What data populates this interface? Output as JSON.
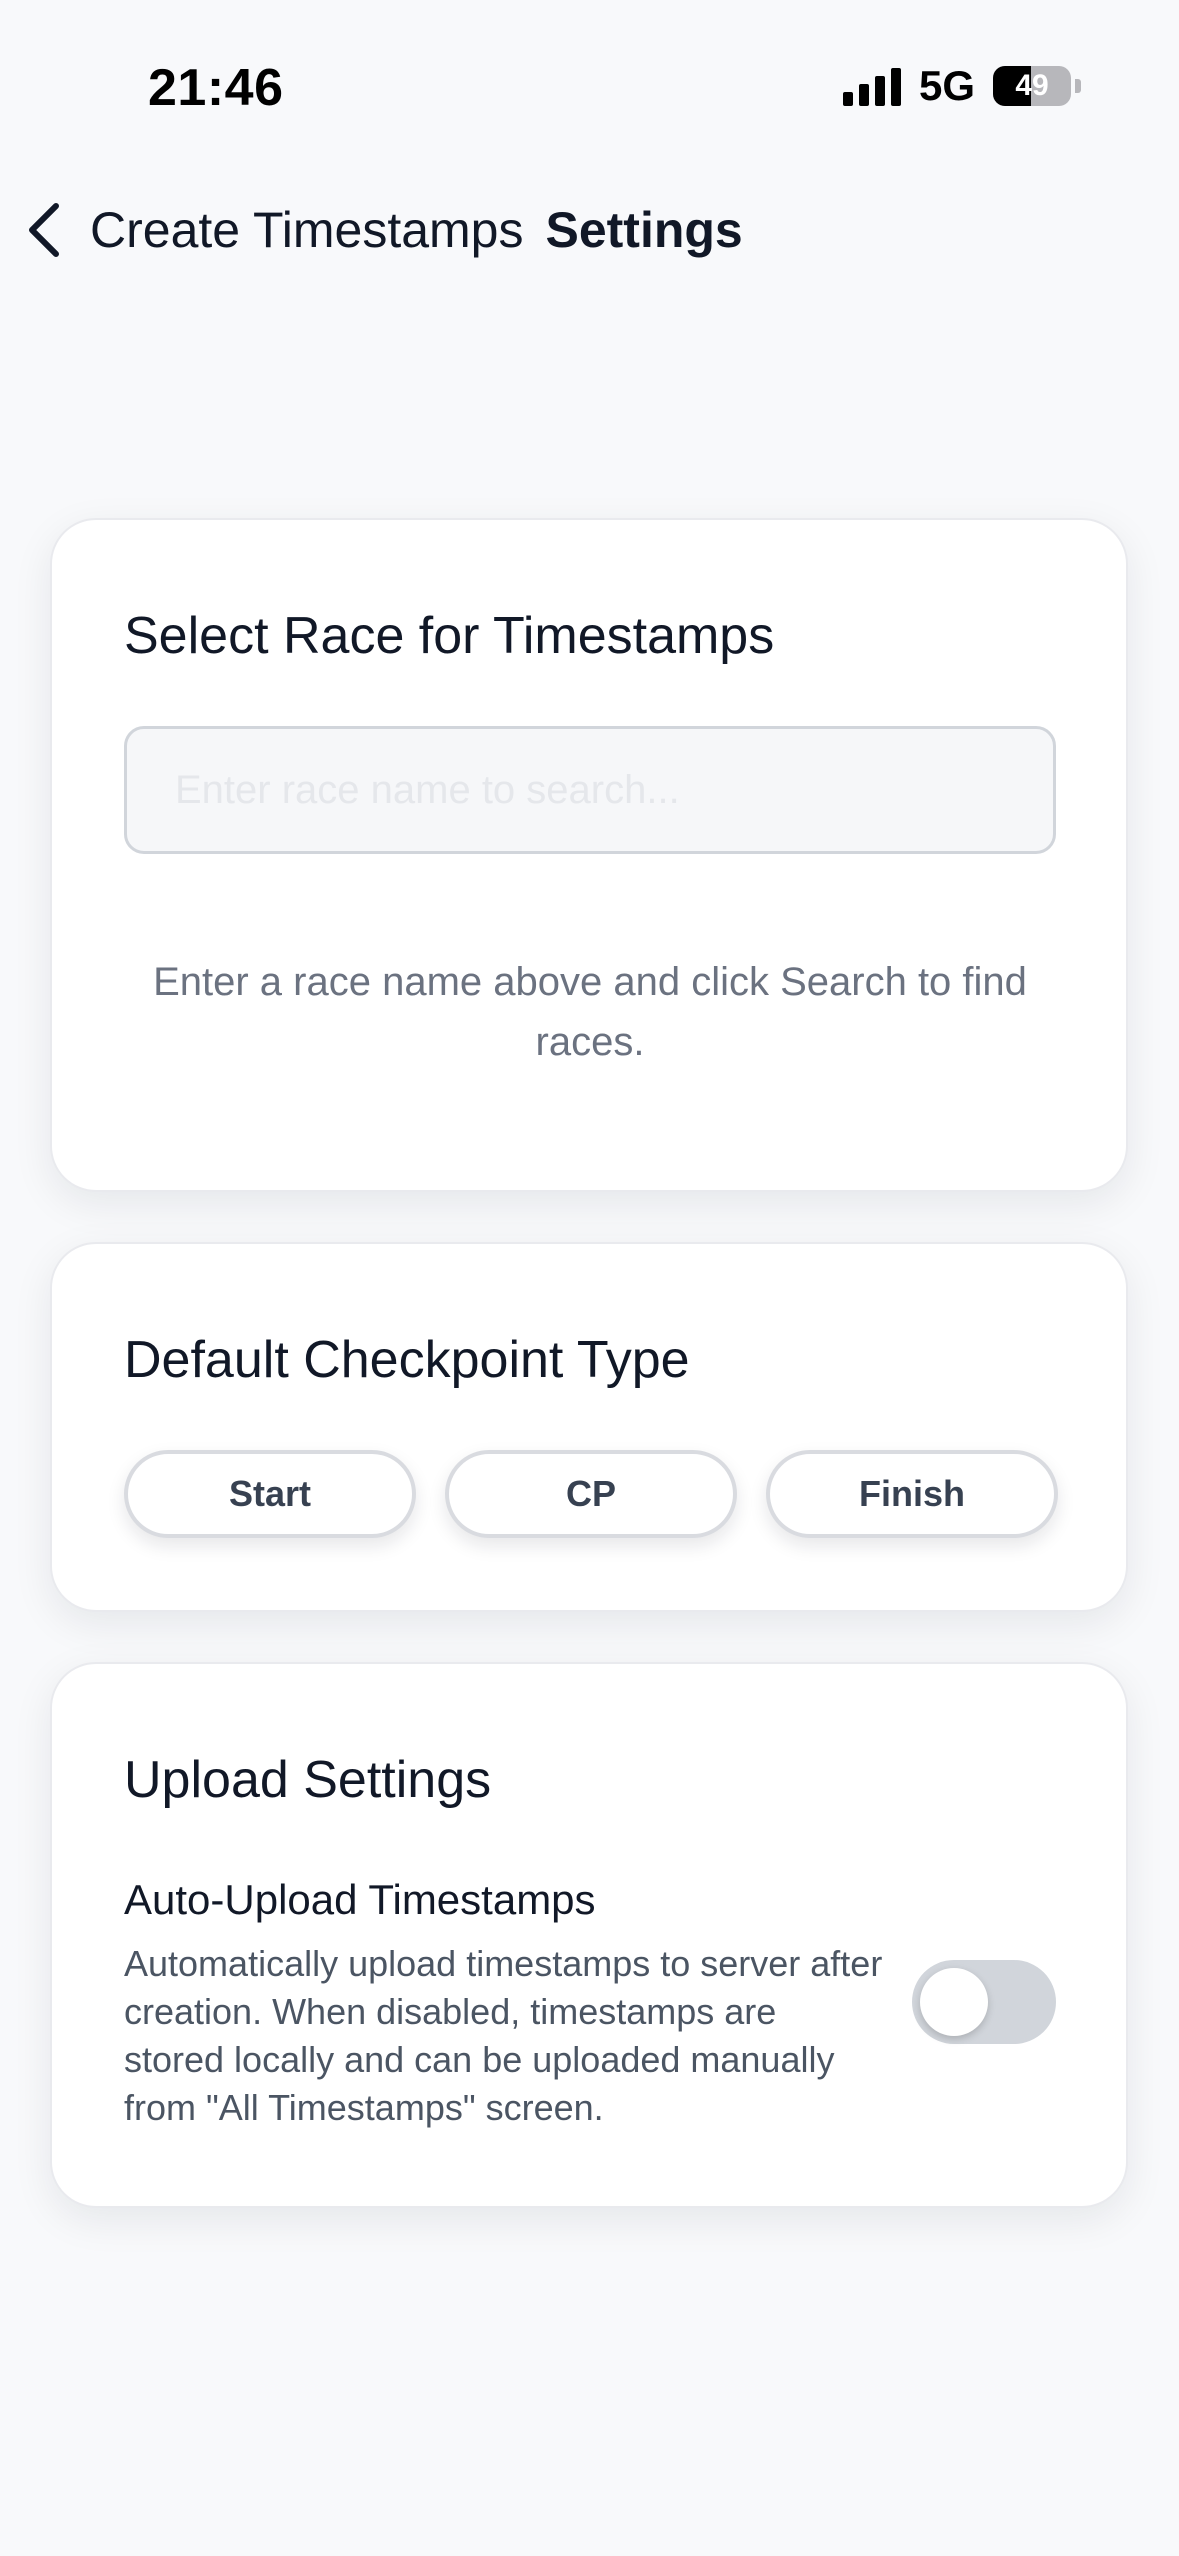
{
  "status_bar": {
    "time": "21:46",
    "network": "5G",
    "battery_percent": 49,
    "battery_label": "49",
    "signal_bars": 4
  },
  "nav": {
    "back_label": "Create Timestamps",
    "title": "Settings"
  },
  "race_section": {
    "title": "Select Race for Timestamps",
    "search_placeholder": "Enter race name to search...",
    "search_value": "",
    "hint": "Enter a race name above and click Search to find races."
  },
  "checkpoint_section": {
    "title": "Default Checkpoint Type",
    "options": [
      "Start",
      "CP",
      "Finish"
    ]
  },
  "upload_section": {
    "title": "Upload Settings",
    "auto_upload_label": "Auto-Upload Timestamps",
    "auto_upload_description": "Automatically upload timestamps to server after creation. When disabled, timestamps are stored locally and can be uploaded manually from \"All Timestamps\" screen.",
    "auto_upload_enabled": false
  },
  "colors": {
    "background": "#f8f9fb",
    "card": "#ffffff",
    "text_primary": "#111827",
    "text_secondary": "#6b7280",
    "toggle_off": "#d1d5db"
  }
}
